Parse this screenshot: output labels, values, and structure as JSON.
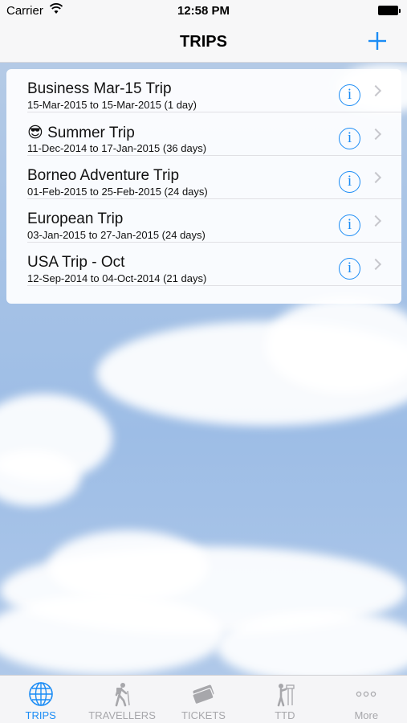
{
  "status_bar": {
    "carrier": "Carrier",
    "time": "12:58 PM"
  },
  "nav": {
    "title": "TRIPS",
    "add_icon": "plus-icon"
  },
  "trips": [
    {
      "emoji": "",
      "name": "Business Mar-15 Trip",
      "dates": "15-Mar-2015 to 15-Mar-2015 (1 day)"
    },
    {
      "emoji": "😎",
      "name": "Summer Trip",
      "dates": "11-Dec-2014 to 17-Jan-2015 (36 days)"
    },
    {
      "emoji": "",
      "name": "Borneo Adventure Trip",
      "dates": "01-Feb-2015 to 25-Feb-2015 (24 days)"
    },
    {
      "emoji": "",
      "name": "European Trip",
      "dates": "03-Jan-2015 to 27-Jan-2015 (24 days)"
    },
    {
      "emoji": "",
      "name": "USA Trip - Oct",
      "dates": "12-Sep-2014 to 04-Oct-2014 (21 days)"
    }
  ],
  "tabs": [
    {
      "label": "TRIPS",
      "icon": "globe-icon",
      "active": true
    },
    {
      "label": "TRAVELLERS",
      "icon": "hiker-icon",
      "active": false
    },
    {
      "label": "TICKETS",
      "icon": "tickets-icon",
      "active": false
    },
    {
      "label": "TTD",
      "icon": "sightseeing-icon",
      "active": false
    },
    {
      "label": "More",
      "icon": "more-icon",
      "active": false
    }
  ],
  "colors": {
    "accent": "#1b8cf5",
    "inactive": "#a7a7ab"
  }
}
